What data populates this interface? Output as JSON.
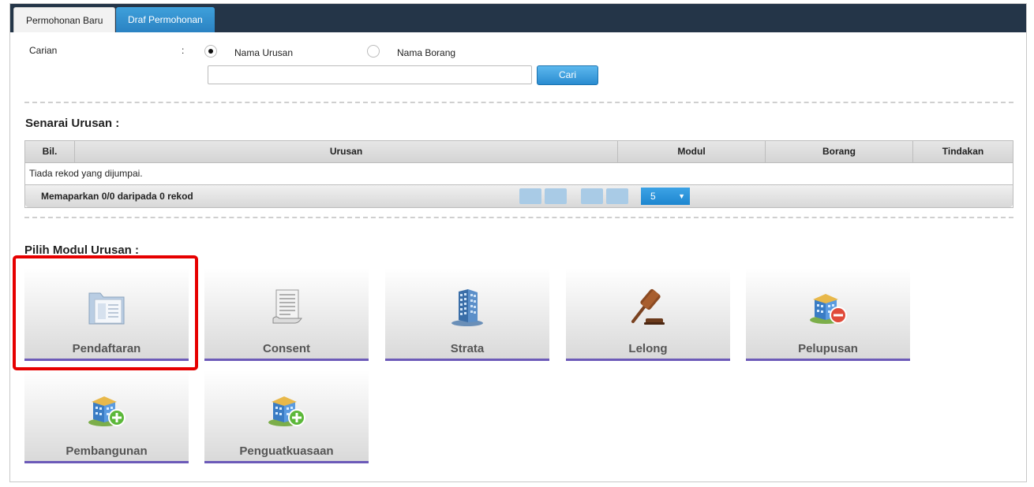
{
  "tabs": [
    {
      "label": "Permohonan Baru"
    },
    {
      "label": "Draf Permohonan"
    }
  ],
  "search": {
    "label": "Carian",
    "colon": ":",
    "radio_options": [
      "Nama Urusan",
      "Nama Borang"
    ],
    "selected_option": "Nama Urusan",
    "input_value": "",
    "button_label": "Cari"
  },
  "list_section": {
    "title": "Senarai Urusan :",
    "columns": [
      "Bil.",
      "Urusan",
      "Modul",
      "Borang",
      "Tindakan"
    ],
    "empty_message": "Tiada rekod yang dijumpai.",
    "footer_info": "Memaparkan 0/0 daripada 0 rekod",
    "page_size": "5"
  },
  "module_section": {
    "title": "Pilih Modul Urusan :",
    "modules": [
      {
        "label": "Pendaftaran",
        "icon": "folder-icon"
      },
      {
        "label": "Consent",
        "icon": "document-icon"
      },
      {
        "label": "Strata",
        "icon": "building-icon"
      },
      {
        "label": "Lelong",
        "icon": "gavel-icon"
      },
      {
        "label": "Pelupusan",
        "icon": "building-minus-icon"
      },
      {
        "label": "Pembangunan",
        "icon": "building-plus-icon"
      },
      {
        "label": "Penguatkuasaan",
        "icon": "building-plus-icon"
      }
    ],
    "highlighted_module": "Pendaftaran"
  },
  "colors": {
    "tab_bar": "#243548",
    "accent_blue": "#2a8bd0",
    "module_underline": "#6c5ab8",
    "highlight_border": "#e60000"
  }
}
